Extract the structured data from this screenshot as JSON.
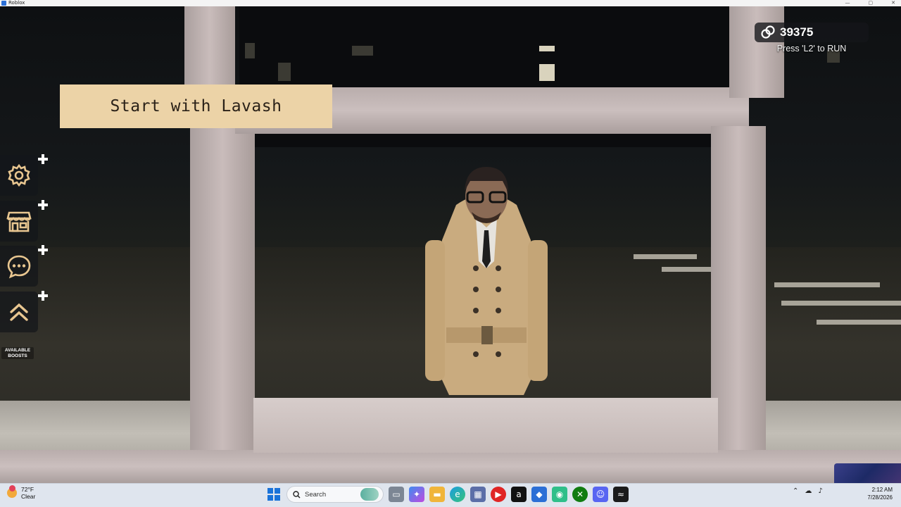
{
  "window": {
    "title": "Roblox",
    "controls": [
      "—",
      "▢",
      "✕"
    ]
  },
  "hud": {
    "objective": "Start with Lavash",
    "currency": {
      "icon": "link-chain-icon",
      "value": "39375"
    },
    "run_hint": "Press 'L2' to RUN",
    "side_menu": [
      {
        "icon": "gear-icon",
        "name": "settings"
      },
      {
        "icon": "shop-icon",
        "name": "shop"
      },
      {
        "icon": "chat-bubble-icon",
        "name": "chat"
      },
      {
        "icon": "double-chevron-up-icon",
        "name": "boosts"
      }
    ],
    "boosts_label": "AVAILABLE BOOSTS"
  },
  "taskbar": {
    "weather": {
      "temp": "72°F",
      "condition": "Clear"
    },
    "search_label": "Search",
    "clock": {
      "time": "2:12 AM",
      "date": "7/28/2026"
    }
  },
  "colors": {
    "objective_bg": "#ecd3a7",
    "hud_icon": "#e8c690"
  }
}
